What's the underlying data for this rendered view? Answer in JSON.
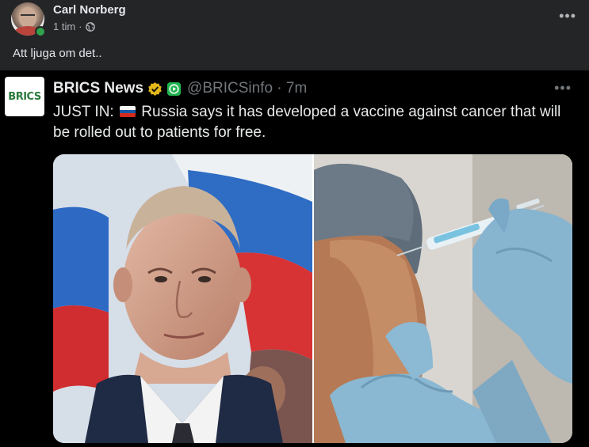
{
  "post": {
    "author": "Carl Norberg",
    "time": "1 tim",
    "separator": "·",
    "text": "Att ljuga om det..",
    "more_label": "•••"
  },
  "tweet": {
    "logo_text": "BRICS",
    "name": "BRICS News",
    "handle": "@BRICSinfo · 7m",
    "more_label": "•••",
    "text_prefix": "JUST IN:",
    "text_body": "Russia says it has developed a vaccine against cancer that will be rolled out to patients for free."
  },
  "colors": {
    "background": "#242526",
    "embed_background": "#000000",
    "online": "#31a24c",
    "verified": "#e2b719",
    "muted": "#71767b"
  },
  "icons": {
    "verified": "verified-badge-icon",
    "play": "play-badge-icon",
    "flag": "russia-flag-icon",
    "globe": "globe-icon",
    "more": "more-options-icon"
  }
}
